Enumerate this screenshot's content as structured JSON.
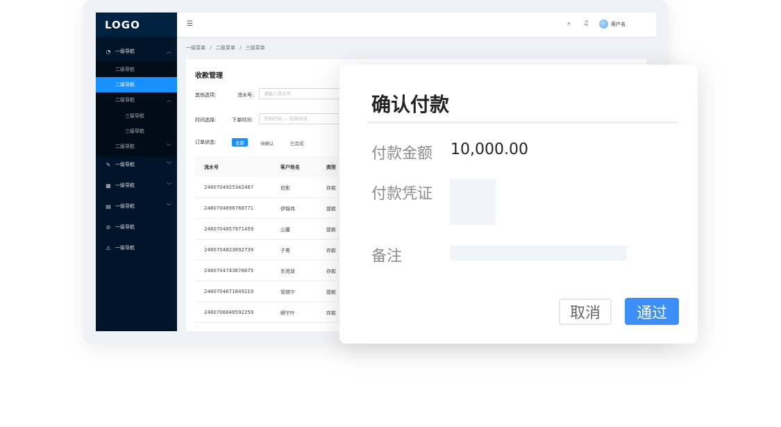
{
  "sidebar": {
    "logo": "LOGO",
    "items": [
      {
        "label": "一级导航"
      },
      {
        "label": "二级导航"
      },
      {
        "label": "二级导航"
      },
      {
        "label": "二级导航"
      },
      {
        "label": "三级导航"
      },
      {
        "label": "三级导航"
      },
      {
        "label": "二级导航"
      },
      {
        "label": "一级导航"
      },
      {
        "label": "一级导航"
      },
      {
        "label": "一级导航"
      },
      {
        "label": "一级导航"
      },
      {
        "label": "一级导航"
      }
    ]
  },
  "header": {
    "username": "用户名"
  },
  "breadcrumb": [
    "一级菜单",
    "/",
    "二级菜单",
    "/",
    "三级菜单"
  ],
  "page": {
    "title": "收款管理",
    "filters": {
      "other_label": "其他选项:",
      "serial_label": "流水号:",
      "serial_placeholder": "请输入流水号",
      "time_label": "时间选择:",
      "order_time_label": "下单时间:",
      "time_placeholder": "开始时间  —  结束时间",
      "status_label": "订单状态:",
      "status_tags": [
        "全部",
        "待确认",
        "已完成"
      ]
    },
    "table": {
      "columns": [
        "流水号",
        "客户姓名",
        "类型"
      ],
      "rows": [
        [
          "2480704925342467",
          "伯影",
          "存款"
        ],
        [
          "2480704896768771",
          "伊锦伟",
          "提款"
        ],
        [
          "2480704857971459",
          "山馨",
          "提款"
        ],
        [
          "2480704823892739",
          "子肴",
          "存款"
        ],
        [
          "2480704743676675",
          "东苑琰",
          "存款"
        ],
        [
          "2480704671849219",
          "管婉宁",
          "提款"
        ],
        [
          "2480706846592259",
          "卿宁叶",
          "存款"
        ]
      ]
    }
  },
  "modal": {
    "title": "确认付款",
    "amount_label": "付款金额",
    "amount_value": "10,000.00",
    "voucher_label": "付款凭证",
    "remark_label": "备注",
    "cancel_label": "取消",
    "ok_label": "通过"
  }
}
